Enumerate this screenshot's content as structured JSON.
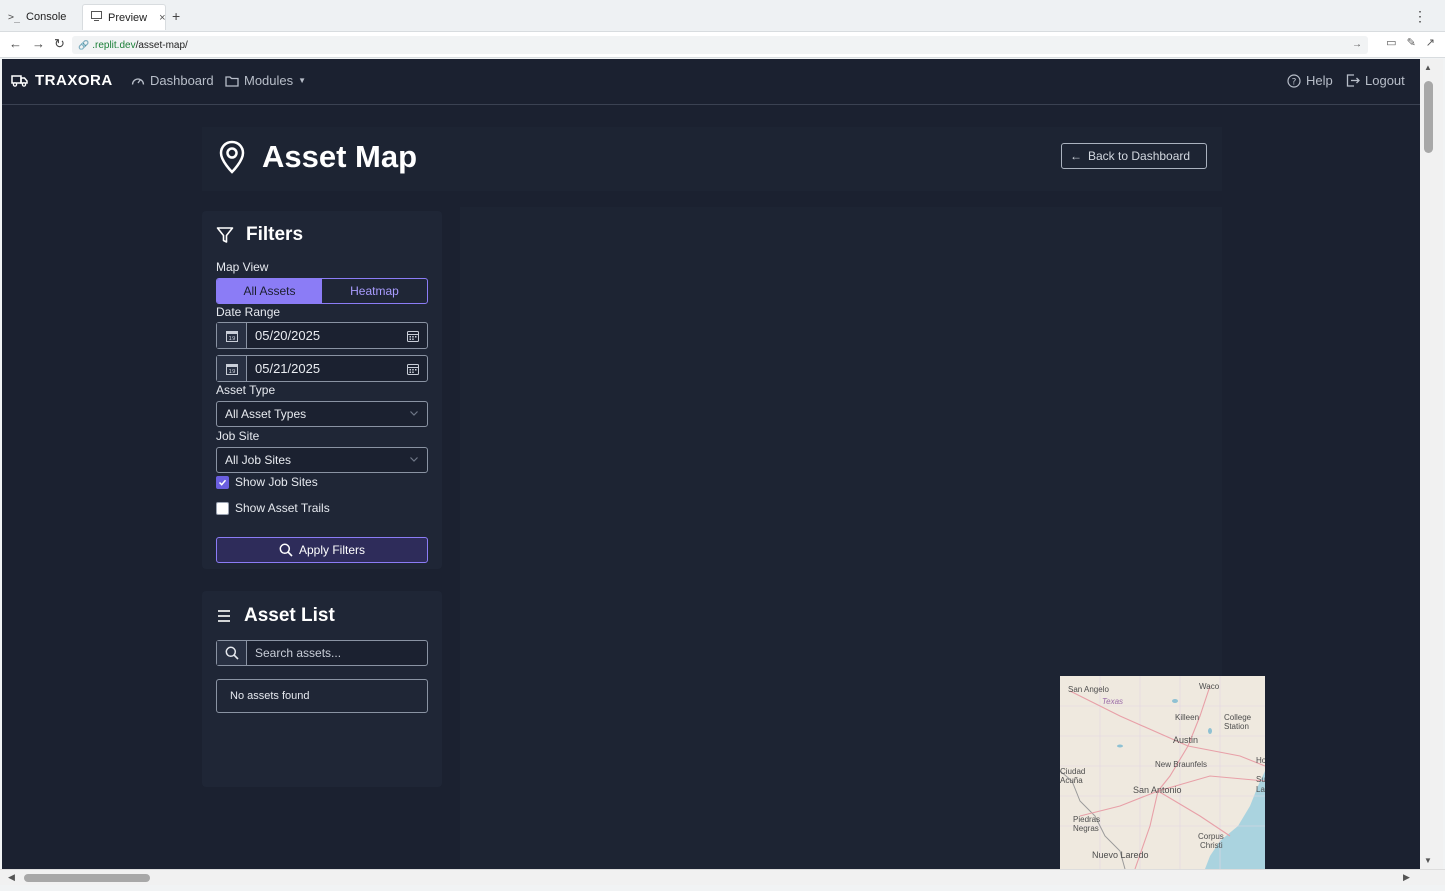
{
  "browser": {
    "tabs": [
      {
        "label": "Console",
        "icon": "terminal-icon"
      },
      {
        "label": "Preview",
        "icon": "monitor-icon",
        "close": "×"
      }
    ],
    "new_tab": "+",
    "menu": "⋮",
    "url": {
      "domain": ".replit.dev",
      "path": "/asset-map/"
    }
  },
  "navbar": {
    "brand": "TRAXORA",
    "dashboard": "Dashboard",
    "modules": "Modules",
    "help": "Help",
    "logout": "Logout"
  },
  "header": {
    "title": "Asset Map",
    "back_button": "Back to Dashboard"
  },
  "filters": {
    "title": "Filters",
    "map_view_label": "Map View",
    "map_view_options": [
      "All Assets",
      "Heatmap"
    ],
    "map_view_selected": "All Assets",
    "date_range_label": "Date Range",
    "date_start": "05/20/2025",
    "date_end": "05/21/2025",
    "date_addon": "19",
    "asset_type_label": "Asset Type",
    "asset_type_value": "All Asset Types",
    "job_site_label": "Job Site",
    "job_site_value": "All Job Sites",
    "show_job_sites_label": "Show Job Sites",
    "show_job_sites": true,
    "show_asset_trails_label": "Show Asset Trails",
    "show_asset_trails": false,
    "apply_label": "Apply Filters"
  },
  "asset_list": {
    "title": "Asset List",
    "search_placeholder": "Search assets...",
    "empty_text": "No assets found"
  },
  "map": {
    "labels": {
      "san_angelo": "San Angelo",
      "waco": "Waco",
      "texas": "Texas",
      "killeen": "Killeen",
      "college": "College",
      "station": "Station",
      "austin": "Austin",
      "new_braunfels": "New Braunfels",
      "ciudad": "Ciudad",
      "acuna": "Acuña",
      "san_antonio": "San Antonio",
      "piedras": "Piedras",
      "negras": "Negras",
      "corpus": "Corpus",
      "christi": "Christi",
      "nuevo_laredo": "Nuevo Laredo",
      "ho": "Ho",
      "su": "Su",
      "la": "La"
    },
    "colors": {
      "land": "#efe9df",
      "water": "#aad3df",
      "road": "#e8a0a8"
    }
  },
  "colors": {
    "app_bg": "#1b2130",
    "card_bg": "#1f2636",
    "accent": "#8b7cf6",
    "text": "#ffffff",
    "muted": "#b8bec9"
  }
}
